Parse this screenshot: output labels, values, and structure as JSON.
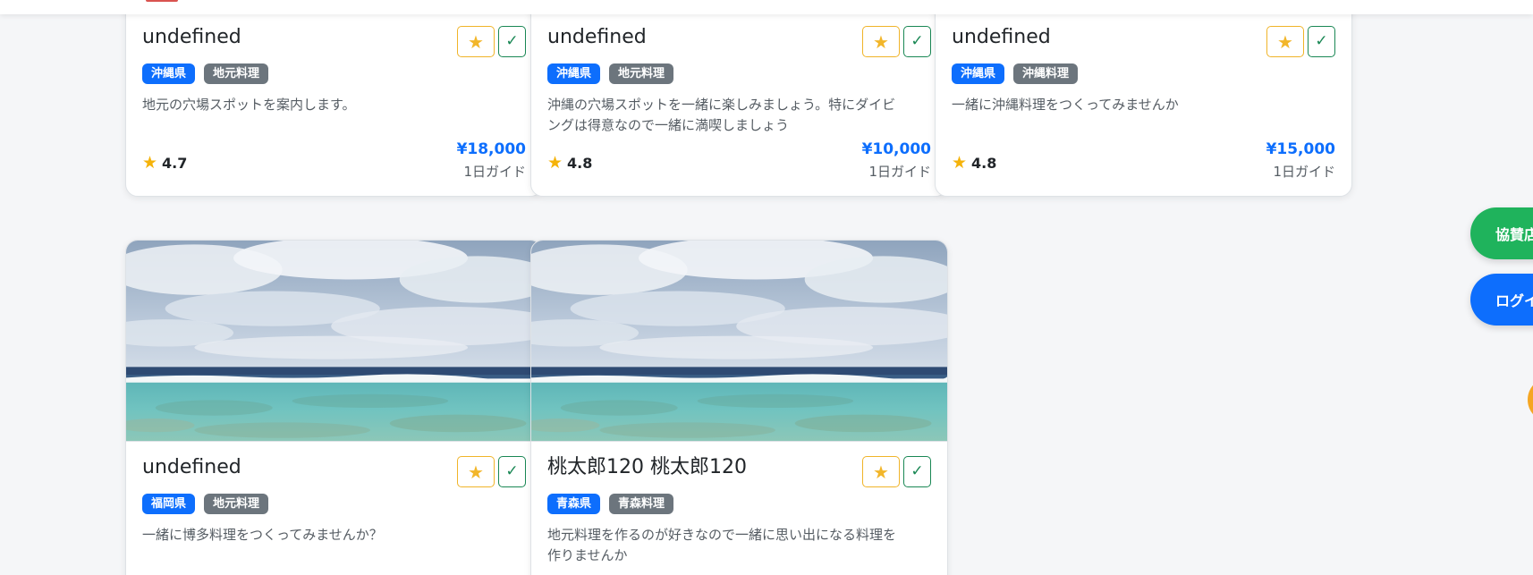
{
  "cards": [
    {
      "title": "undefined",
      "prefecture": "沖縄県",
      "category": "地元料理",
      "description": "地元の穴場スポットを案内します。",
      "rating": "4.7",
      "price": "¥18,000",
      "unit": "1日ガイド"
    },
    {
      "title": "undefined",
      "prefecture": "沖縄県",
      "category": "地元料理",
      "description": "沖縄の穴場スポットを一緒に楽しみましょう。特にダイビングは得意なので一緒に満喫しましょう",
      "rating": "4.8",
      "price": "¥10,000",
      "unit": "1日ガイド"
    },
    {
      "title": "undefined",
      "prefecture": "沖縄県",
      "category": "沖縄料理",
      "description": "一緒に沖縄料理をつくってみませんか",
      "rating": "4.8",
      "price": "¥15,000",
      "unit": "1日ガイド"
    },
    {
      "title": "undefined",
      "prefecture": "福岡県",
      "category": "地元料理",
      "description": "一緒に博多料理をつくってみませんか？"
    },
    {
      "title": "桃太郎120 桃太郎120",
      "prefecture": "青森県",
      "category": "青森料理",
      "description": "地元料理を作るのが好きなので一緒に思い出になる料理を作りませんか"
    }
  ],
  "buttons": {
    "favorite_icon": "★",
    "check_icon": "✓",
    "star_icon": "★"
  },
  "side": {
    "sponsor_label": "協賛店",
    "login_label": "ログイン"
  },
  "colors": {
    "primary": "#0d6efd",
    "tag_gray": "#6c757d",
    "success": "#198754",
    "sponsor_green": "#1fb35c",
    "star_gold": "#f5b30a"
  }
}
